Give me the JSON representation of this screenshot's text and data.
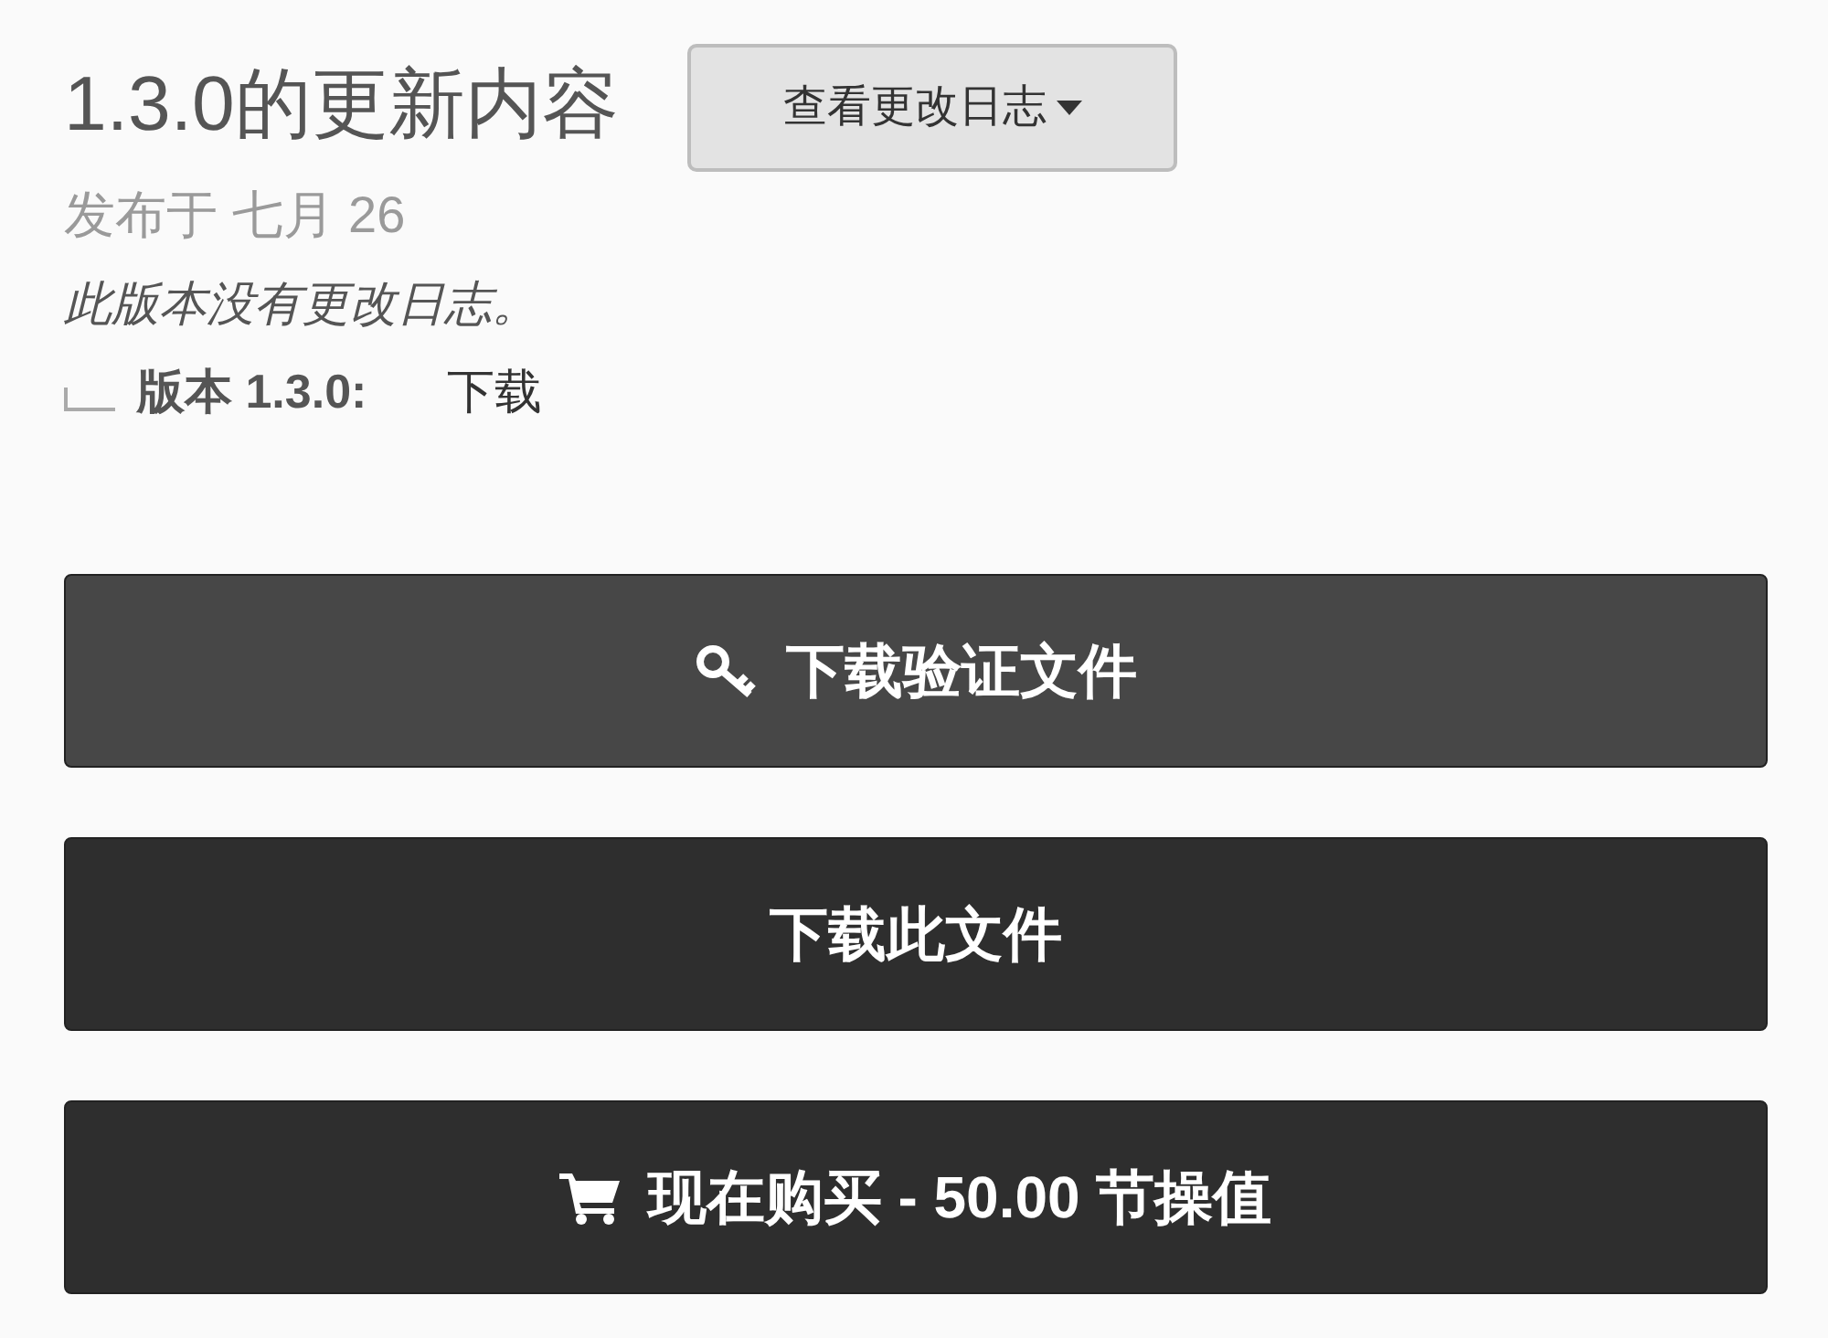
{
  "header": {
    "title": "1.3.0的更新内容",
    "changelog_button": "查看更改日志"
  },
  "release_date": "发布于 七月 26",
  "changelog_note": "此版本没有更改日志。",
  "version": {
    "label": "版本 1.3.0:",
    "download_link": "下载"
  },
  "actions": [
    {
      "kind": "verification",
      "label": "下载验证文件"
    },
    {
      "kind": "download",
      "label": "下载此文件"
    },
    {
      "kind": "purchase",
      "label": "现在购买 - 50.00 节操值"
    }
  ]
}
